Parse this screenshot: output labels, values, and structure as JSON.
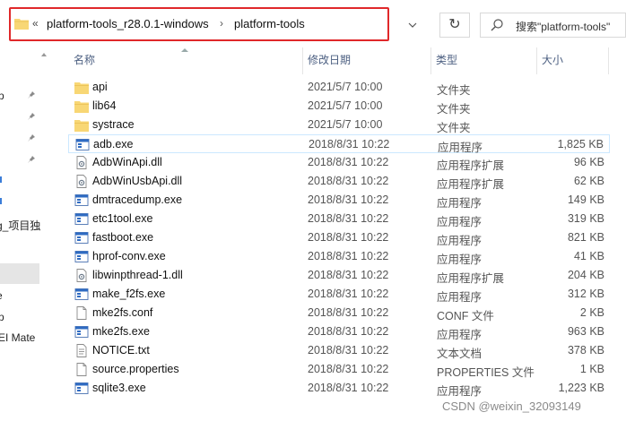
{
  "address_bar": {
    "chevron": "«",
    "crumbs": [
      "platform-tools_r28.0.1-windows",
      "platform-tools"
    ],
    "separator": "›"
  },
  "refresh_glyph": "↻",
  "search": {
    "placeholder": "搜索\"platform-tools\""
  },
  "nav_pane": {
    "items": [
      "p",
      "g_项目独",
      "e",
      "p",
      "EI Mate"
    ]
  },
  "columns": {
    "name": "名称",
    "date": "修改日期",
    "type": "类型",
    "size": "大小"
  },
  "files": [
    {
      "name": "api",
      "date": "2021/5/7 10:00",
      "type": "文件夹",
      "size": "",
      "icon": "folder-icon"
    },
    {
      "name": "lib64",
      "date": "2021/5/7 10:00",
      "type": "文件夹",
      "size": "",
      "icon": "folder-icon"
    },
    {
      "name": "systrace",
      "date": "2021/5/7 10:00",
      "type": "文件夹",
      "size": "",
      "icon": "folder-icon"
    },
    {
      "name": "adb.exe",
      "date": "2018/8/31 10:22",
      "type": "应用程序",
      "size": "1,825 KB",
      "icon": "exe-icon"
    },
    {
      "name": "AdbWinApi.dll",
      "date": "2018/8/31 10:22",
      "type": "应用程序扩展",
      "size": "96 KB",
      "icon": "dll-icon"
    },
    {
      "name": "AdbWinUsbApi.dll",
      "date": "2018/8/31 10:22",
      "type": "应用程序扩展",
      "size": "62 KB",
      "icon": "dll-icon"
    },
    {
      "name": "dmtracedump.exe",
      "date": "2018/8/31 10:22",
      "type": "应用程序",
      "size": "149 KB",
      "icon": "exe-icon"
    },
    {
      "name": "etc1tool.exe",
      "date": "2018/8/31 10:22",
      "type": "应用程序",
      "size": "319 KB",
      "icon": "exe-icon"
    },
    {
      "name": "fastboot.exe",
      "date": "2018/8/31 10:22",
      "type": "应用程序",
      "size": "821 KB",
      "icon": "exe-icon"
    },
    {
      "name": "hprof-conv.exe",
      "date": "2018/8/31 10:22",
      "type": "应用程序",
      "size": "41 KB",
      "icon": "exe-icon"
    },
    {
      "name": "libwinpthread-1.dll",
      "date": "2018/8/31 10:22",
      "type": "应用程序扩展",
      "size": "204 KB",
      "icon": "dll-icon"
    },
    {
      "name": "make_f2fs.exe",
      "date": "2018/8/31 10:22",
      "type": "应用程序",
      "size": "312 KB",
      "icon": "exe-icon"
    },
    {
      "name": "mke2fs.conf",
      "date": "2018/8/31 10:22",
      "type": "CONF 文件",
      "size": "2 KB",
      "icon": "file-icon"
    },
    {
      "name": "mke2fs.exe",
      "date": "2018/8/31 10:22",
      "type": "应用程序",
      "size": "963 KB",
      "icon": "exe-icon"
    },
    {
      "name": "NOTICE.txt",
      "date": "2018/8/31 10:22",
      "type": "文本文档",
      "size": "378 KB",
      "icon": "txt-icon"
    },
    {
      "name": "source.properties",
      "date": "2018/8/31 10:22",
      "type": "PROPERTIES 文件",
      "size": "1 KB",
      "icon": "file-icon"
    },
    {
      "name": "sqlite3.exe",
      "date": "2018/8/31 10:22",
      "type": "应用程序",
      "size": "1,223 KB",
      "icon": "exe-icon"
    }
  ],
  "selected_file": "adb.exe",
  "watermark": "CSDN @weixin_32093149",
  "colors": {
    "highlight_border": "#e0282a",
    "selected_row_border": "#cce8ff",
    "folder": "#f8d775",
    "header_text": "#4d6082"
  }
}
